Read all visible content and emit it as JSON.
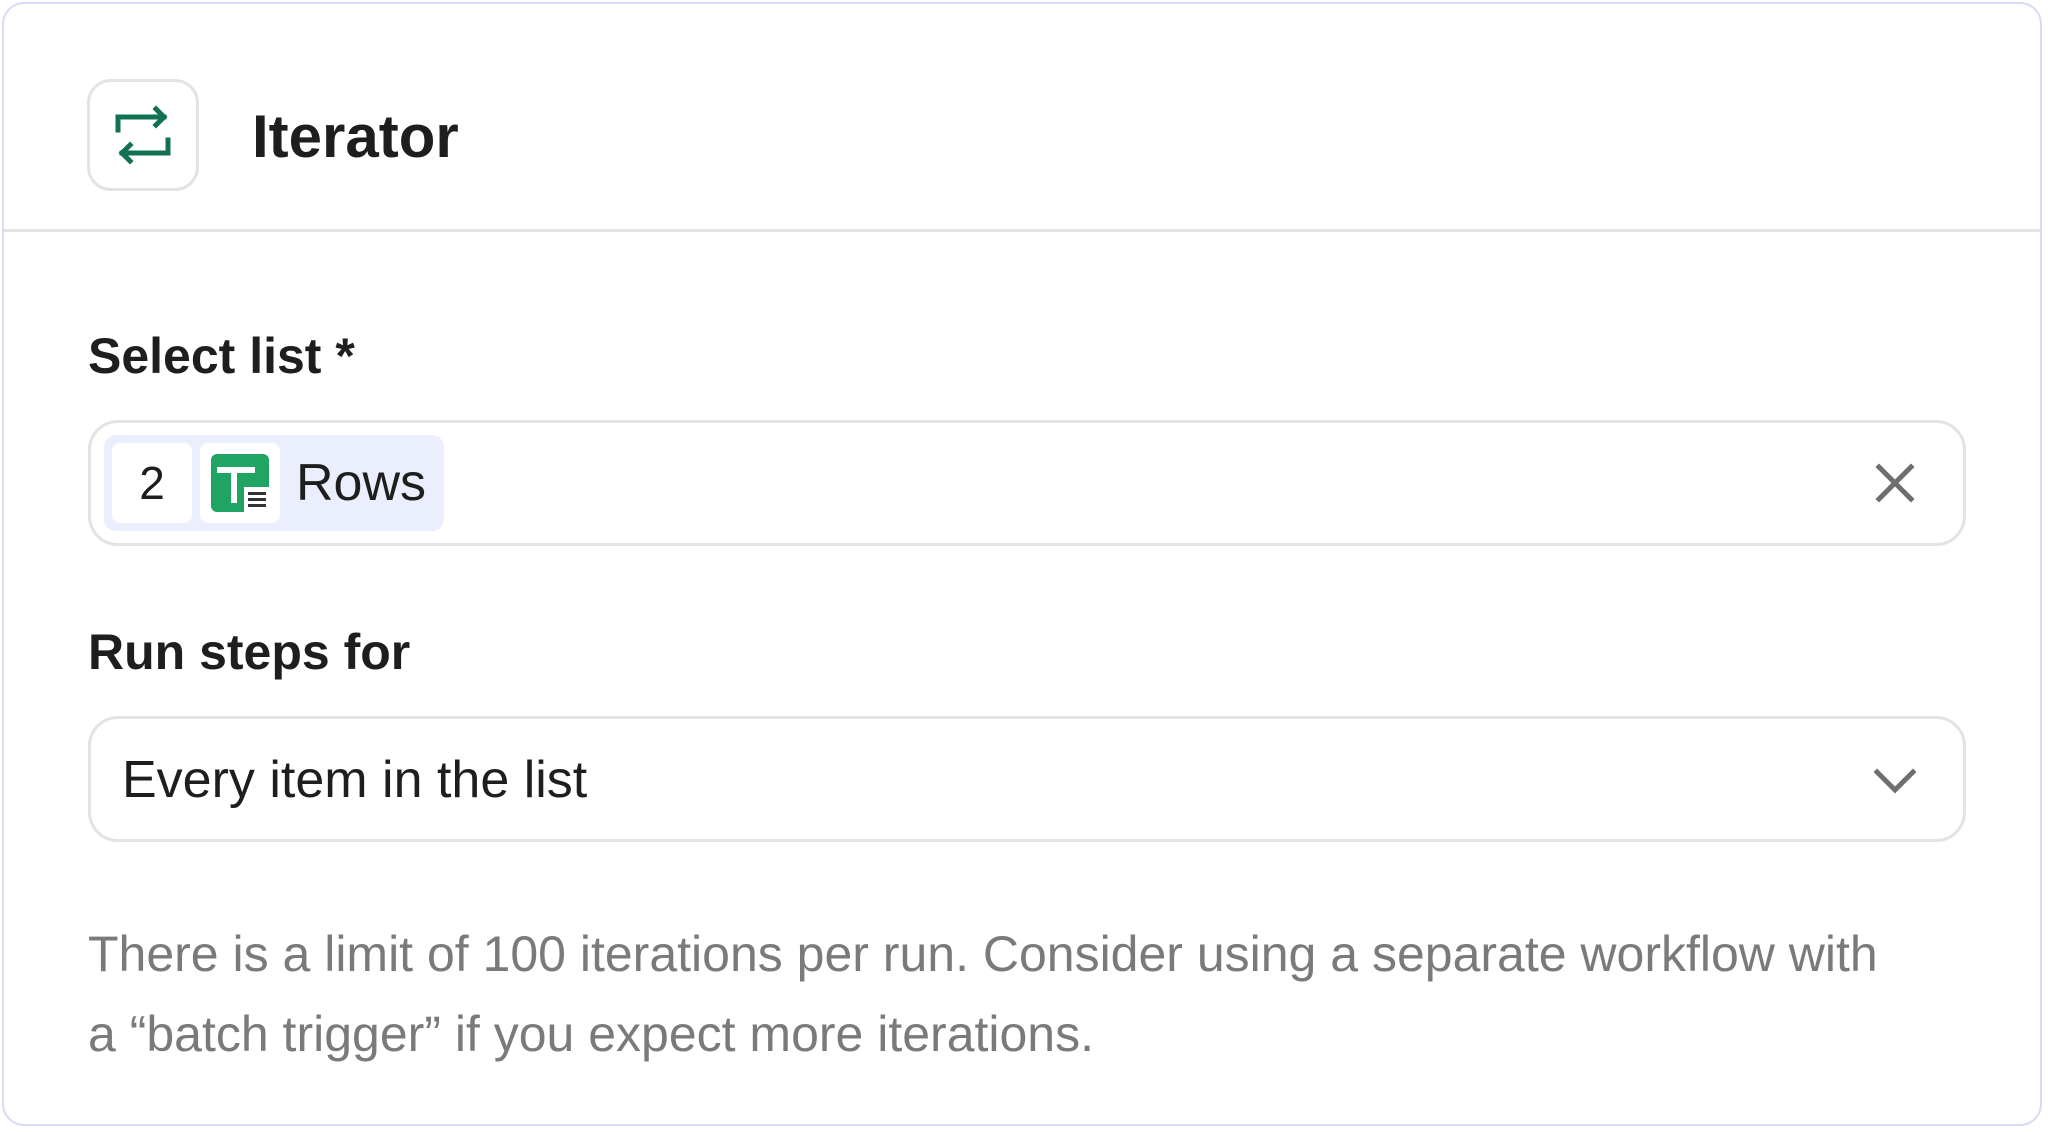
{
  "node": {
    "title": "Iterator",
    "icon": "repeat-arrows-icon",
    "icon_color": "#127152"
  },
  "select_list": {
    "label": "Select list *",
    "chip": {
      "step_number": "2",
      "app_icon": "google-sheets-icon",
      "app_color": "#1fa463",
      "label": "Rows"
    },
    "clear_icon": "close-icon"
  },
  "run_steps_for": {
    "label": "Run steps for",
    "value": "Every item in the list",
    "dropdown_icon": "chevron-down-icon"
  },
  "help_text": "There is a limit of 100 iterations per run. Consider using a separate workflow with a “batch trigger” if you expect more iterations.",
  "colors": {
    "panel_border": "#d6daf5",
    "chip_background": "#ebeefd",
    "divider": "#e3e3e3",
    "muted_text": "#7a7a7a"
  }
}
